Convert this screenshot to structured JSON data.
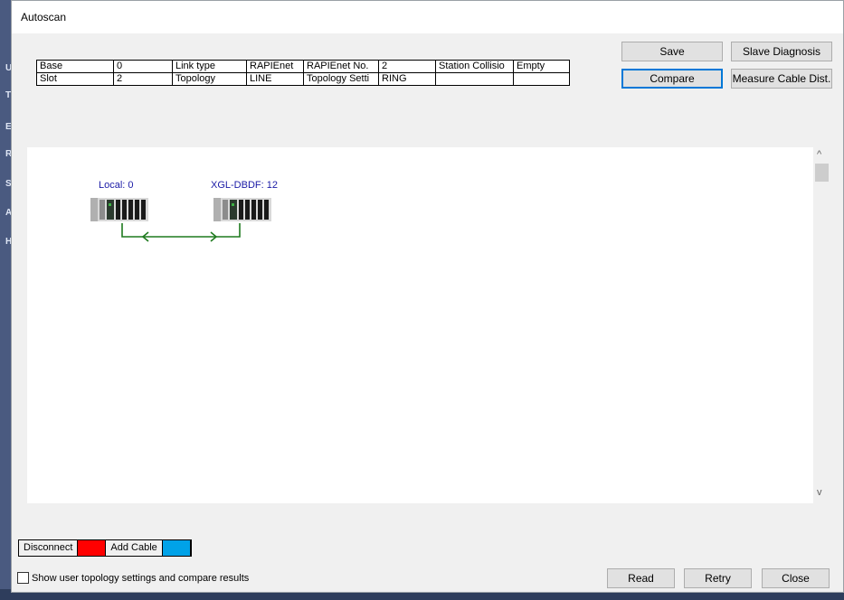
{
  "window": {
    "title": "Autoscan"
  },
  "background": {
    "side_letters": [
      "U",
      "T",
      "E",
      "R",
      "S",
      "A",
      "H"
    ]
  },
  "info_table": {
    "rows": [
      [
        "Base",
        "0",
        "Link type",
        "RAPIEnet",
        "RAPIEnet No.",
        "2",
        "Station Collisio",
        "Empty"
      ],
      [
        "Slot",
        "2",
        "Topology",
        "LINE",
        "Topology Setti",
        "RING",
        "",
        ""
      ]
    ]
  },
  "buttons": {
    "save": "Save",
    "slave_diagnosis": "Slave Diagnosis",
    "compare": "Compare",
    "measure_cable": "Measure Cable Dist.",
    "read": "Read",
    "retry": "Retry",
    "close": "Close"
  },
  "topology": {
    "nodes": [
      {
        "label": "Local: 0"
      },
      {
        "label": "XGL-DBDF: 12"
      }
    ],
    "link_color": "#1e7a1e",
    "label_color": "#1a1aa6"
  },
  "legend": {
    "disconnect_label": "Disconnect",
    "disconnect_color": "#ff0000",
    "add_cable_label": "Add Cable",
    "add_cable_color": "#00a2e8"
  },
  "option": {
    "show_user_topology_label": "Show user topology settings and compare results",
    "checked": false
  },
  "scroll": {
    "up_icon": "^",
    "down_icon": "v"
  }
}
